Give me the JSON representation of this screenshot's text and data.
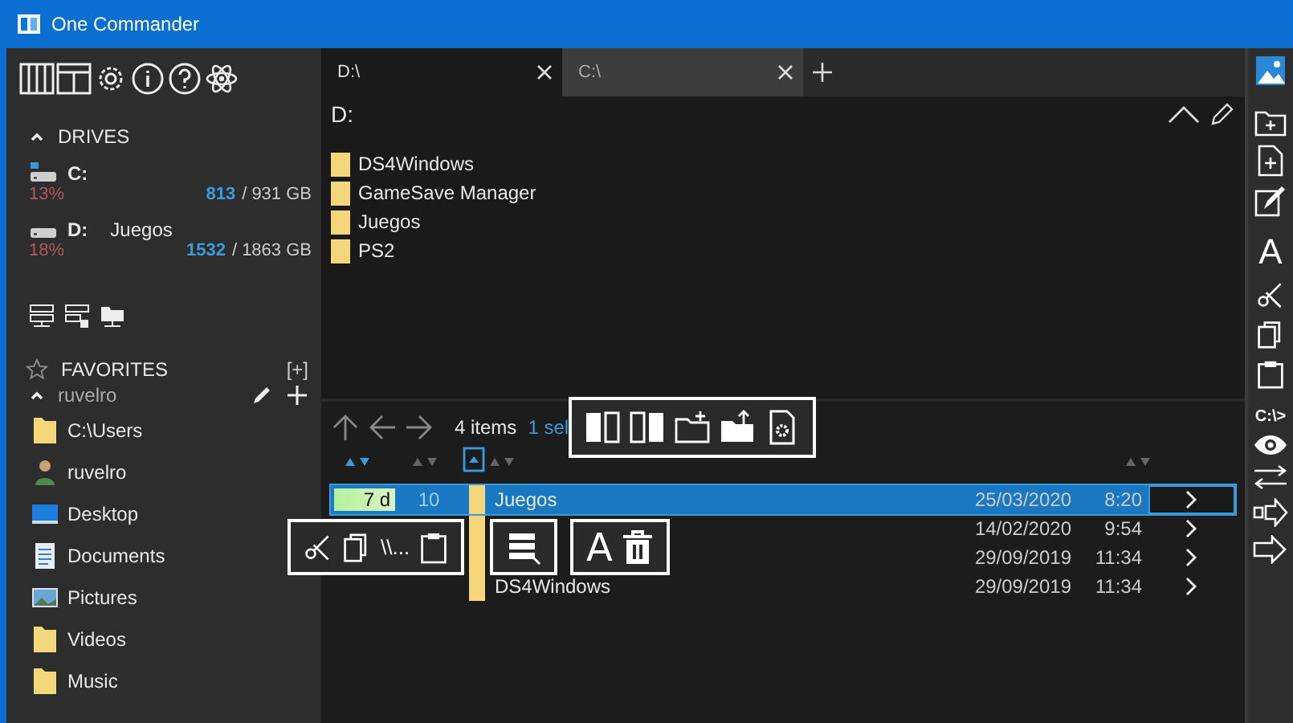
{
  "window": {
    "title": "One Commander"
  },
  "drives_header": "DRIVES",
  "drives": [
    {
      "letter": "C:",
      "percent": "13%",
      "free": "813",
      "total": "/ 931 GB",
      "system": true
    },
    {
      "letter": "D:",
      "label": "Juegos",
      "percent": "18%",
      "free": "1532",
      "total": "/ 1863 GB",
      "system": false
    }
  ],
  "favorites": {
    "title": "FAVORITES",
    "add": "[+]",
    "group": "ruvelro",
    "expanded": true,
    "items": [
      {
        "kind": "folder",
        "label": "C:\\Users"
      },
      {
        "kind": "user",
        "label": "ruvelro"
      },
      {
        "kind": "desktop",
        "label": "Desktop"
      },
      {
        "kind": "documents",
        "label": "Documents"
      },
      {
        "kind": "pictures",
        "label": "Pictures"
      },
      {
        "kind": "folder",
        "label": "Videos"
      },
      {
        "kind": "folder",
        "label": "Music"
      }
    ]
  },
  "tabs": [
    {
      "label": "D:\\",
      "selected": true
    },
    {
      "label": "C:\\",
      "selected": false
    }
  ],
  "top_pane": {
    "path": "D:",
    "items": [
      "DS4Windows",
      "GameSave Manager",
      "Juegos",
      "PS2"
    ]
  },
  "bottom_pane": {
    "count": "4 items",
    "selection": "1 sel",
    "rows": [
      {
        "age": "7 d",
        "count": "10",
        "name": "Juegos",
        "date": "25/03/2020",
        "time": "8:20",
        "selected": true
      },
      {
        "date": "14/02/2020",
        "time": "9:54",
        "selected": false
      },
      {
        "date": "29/09/2019",
        "time": "11:34",
        "selected": false
      },
      {
        "name": "DS4Windows",
        "date": "29/09/2019",
        "time": "11:34",
        "selected": false
      }
    ]
  },
  "toolbar_glyphs": {
    "path_copy": "\\\\...",
    "rename": "A",
    "side_rename": "A",
    "terminal": "C:\\>"
  }
}
